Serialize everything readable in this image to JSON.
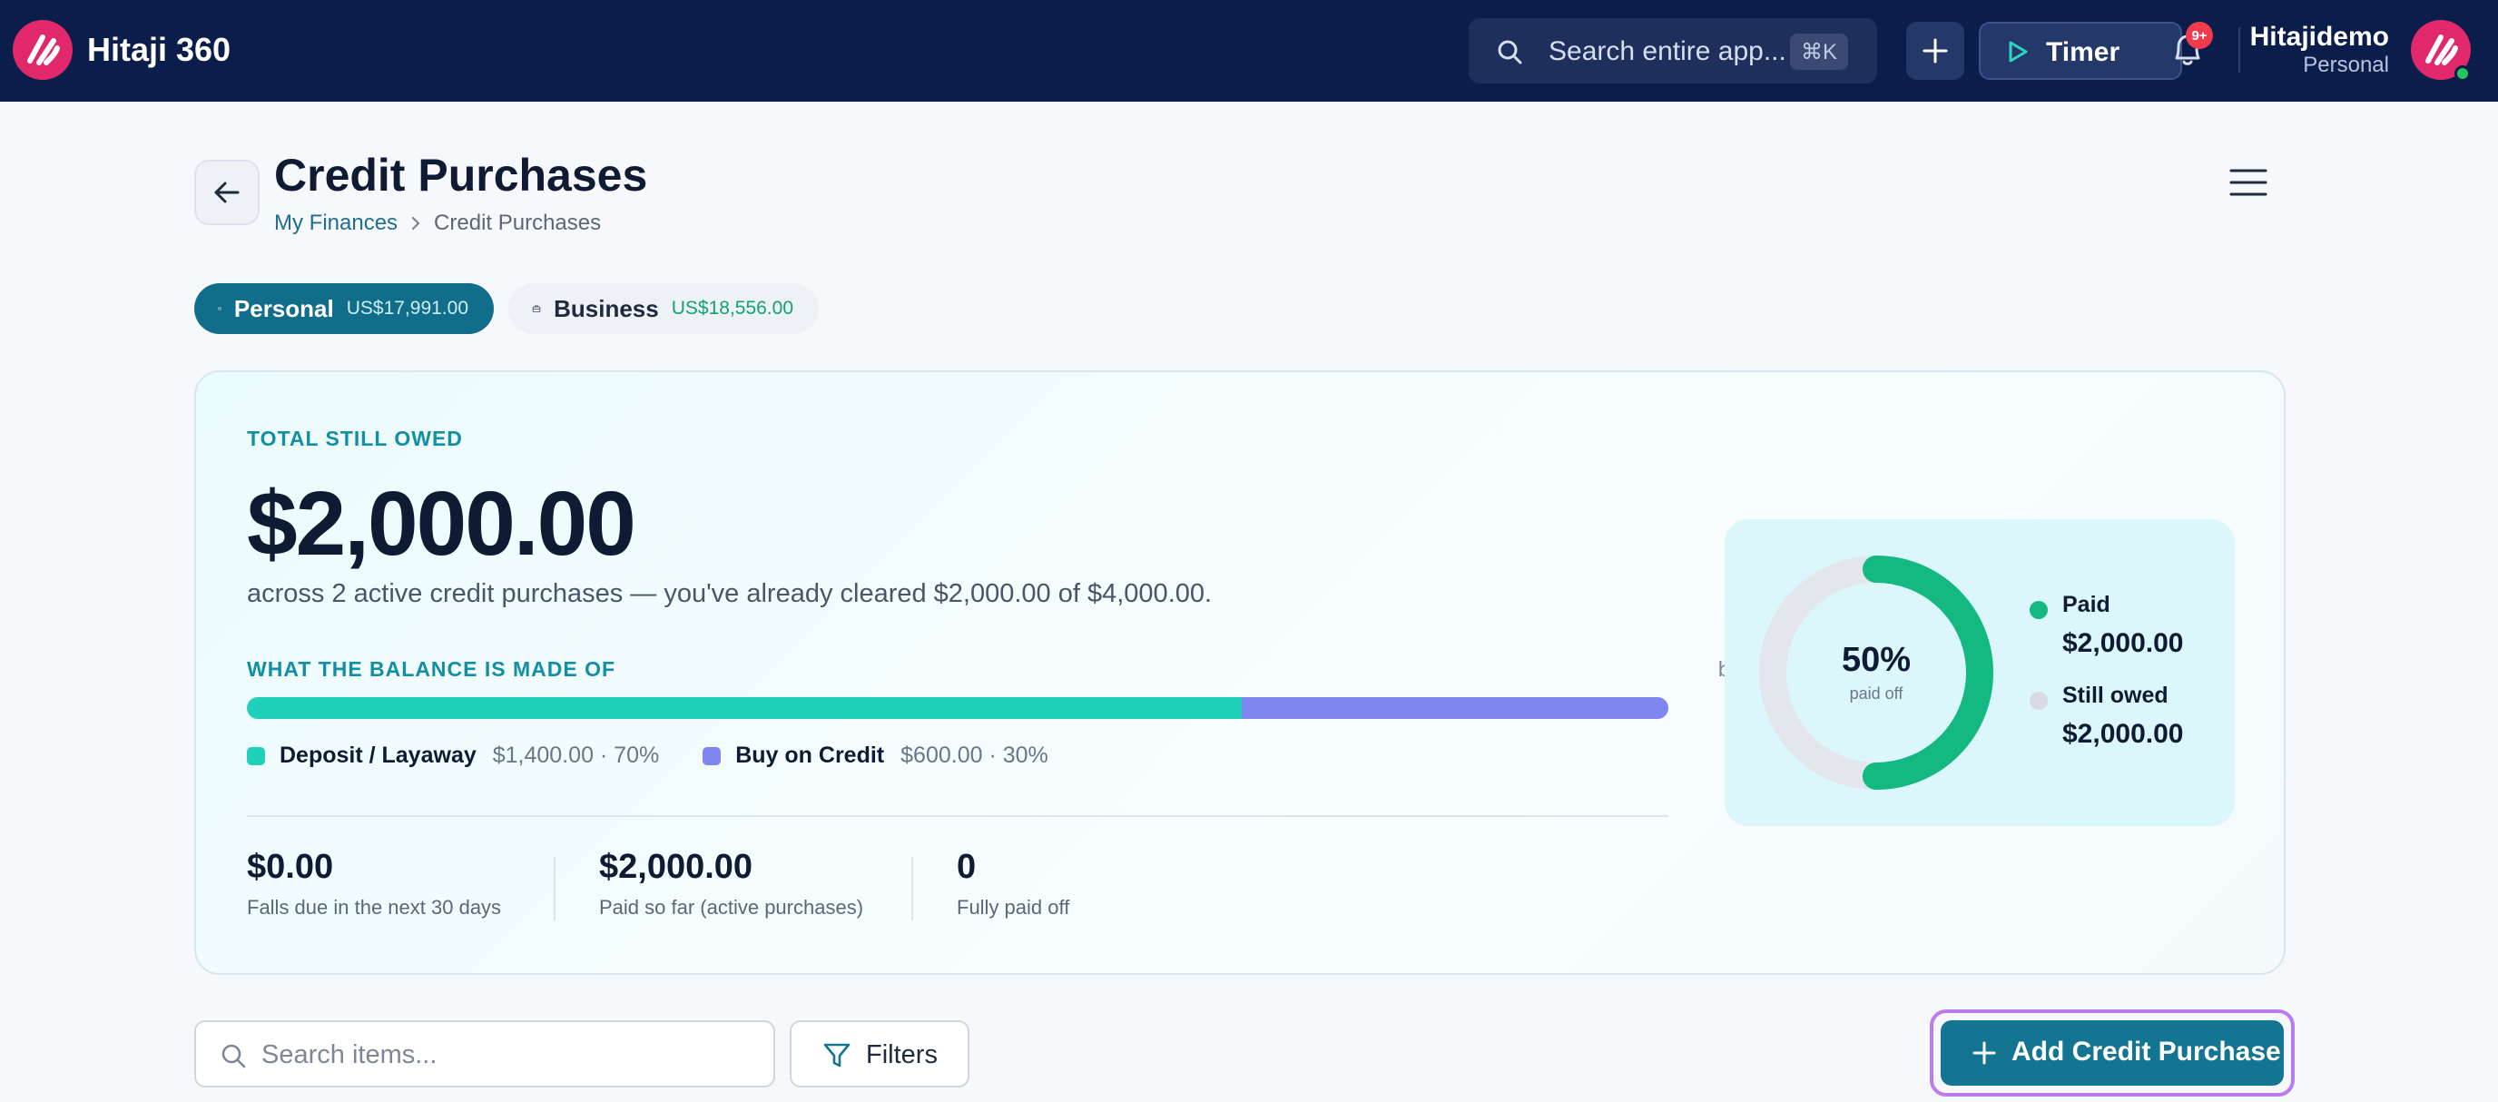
{
  "app": {
    "name": "Hitaji 360"
  },
  "topbar": {
    "search_placeholder": "Search entire app...",
    "search_shortcut": "⌘K",
    "timer_label": "Timer",
    "notification_count": "9+",
    "user_name": "Hitajidemo",
    "user_context": "Personal"
  },
  "page": {
    "title": "Credit Purchases",
    "breadcrumb": [
      "My Finances",
      "Credit Purchases"
    ]
  },
  "tabs": [
    {
      "label": "Personal",
      "amount": "US$17,991.00",
      "active": true
    },
    {
      "label": "Business",
      "amount": "US$18,556.00",
      "active": false
    }
  ],
  "summary": {
    "eyebrow": "TOTAL STILL OWED",
    "total_owed": "$2,000.00",
    "subline": "across 2 active credit purchases — you've already cleared $2,000.00 of $4,000.00.",
    "composition_title": "WHAT THE BALANCE IS MADE OF",
    "composition_hint": "by purchase type",
    "composition": [
      {
        "name": "Deposit / Layaway",
        "value": "$1,400.00 · 70%",
        "percent": 70,
        "color": "#1fd1b8"
      },
      {
        "name": "Buy on Credit",
        "value": "$600.00 · 30%",
        "percent": 30,
        "color": "#7f86f2"
      }
    ],
    "stats": [
      {
        "value": "$0.00",
        "label": "Falls due in the next 30 days"
      },
      {
        "value": "$2,000.00",
        "label": "Paid so far (active purchases)"
      },
      {
        "value": "0",
        "label": "Fully paid off"
      }
    ],
    "donut": {
      "percent_label": "50%",
      "sub_label": "paid off",
      "paid_fraction": 0.5,
      "paid_color": "#13b981",
      "rest_color": "#e4e6ee",
      "legend": [
        {
          "name": "Paid",
          "value": "$2,000.00",
          "color": "#13b981"
        },
        {
          "name": "Still owed",
          "value": "$2,000.00",
          "color": "#d8dbe3"
        }
      ]
    }
  },
  "toolbar": {
    "search_placeholder": "Search items...",
    "filters_label": "Filters",
    "add_label": "Add Credit Purchase"
  }
}
